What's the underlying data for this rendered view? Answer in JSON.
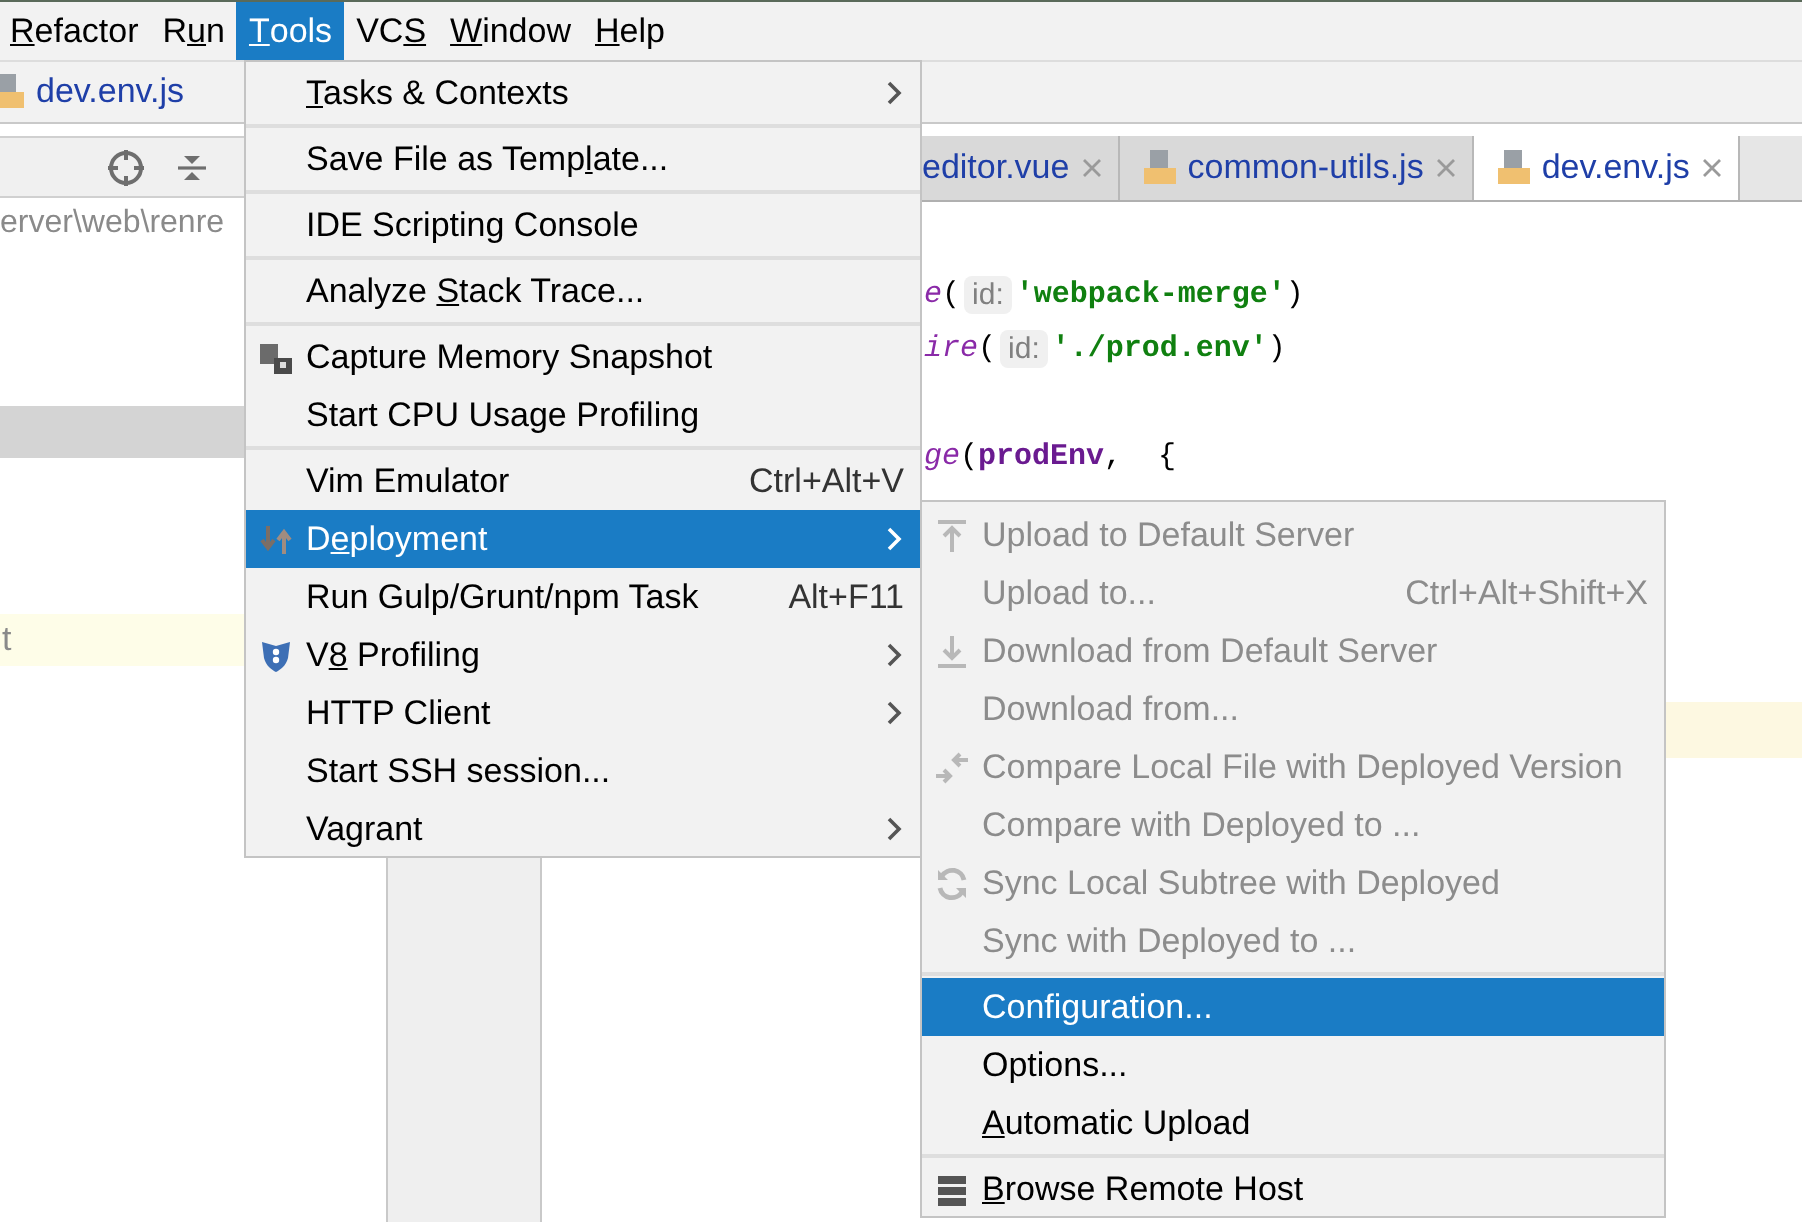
{
  "menubar": [
    {
      "label": "Refactor",
      "selected": false
    },
    {
      "label": "Run",
      "selected": false
    },
    {
      "label": "Tools",
      "selected": true
    },
    {
      "label": "VCS",
      "selected": false
    },
    {
      "label": "Window",
      "selected": false
    },
    {
      "label": "Help",
      "selected": false
    }
  ],
  "navbar": {
    "file": "dev.env.js"
  },
  "project_panel": {
    "path": "erver\\web\\renre",
    "row_text": "t"
  },
  "editor": {
    "tabs": [
      {
        "label": "editor.vue",
        "selected": false,
        "file_icon": false
      },
      {
        "label": "common-utils.js",
        "selected": false,
        "file_icon": true
      },
      {
        "label": "dev.env.js",
        "selected": true,
        "file_icon": true
      }
    ],
    "code_lines": [
      {
        "tokens": [
          {
            "kind": "call",
            "text": "e"
          },
          {
            "kind": "punct",
            "text": "("
          },
          {
            "kind": "hint",
            "text": "id:"
          },
          {
            "kind": "string",
            "text": "'webpack-merge'"
          },
          {
            "kind": "punct",
            "text": ")"
          }
        ]
      },
      {
        "tokens": [
          {
            "kind": "call",
            "text": "ire"
          },
          {
            "kind": "punct",
            "text": "("
          },
          {
            "kind": "hint",
            "text": "id:"
          },
          {
            "kind": "string",
            "text": "'./prod.env'"
          },
          {
            "kind": "punct",
            "text": ")"
          }
        ]
      },
      {
        "tokens": [
          {
            "kind": "call",
            "text": "ge"
          },
          {
            "kind": "punct",
            "text": "("
          },
          {
            "kind": "var",
            "text": "prodEnv"
          },
          {
            "kind": "punct",
            "text": ",  {"
          }
        ]
      }
    ]
  },
  "tools_menu": [
    {
      "kind": "submenu",
      "label": "Tasks & Contexts",
      "selected": false
    },
    {
      "kind": "separator"
    },
    {
      "kind": "item",
      "label": "Save File as Template...",
      "selected": false
    },
    {
      "kind": "separator"
    },
    {
      "kind": "item",
      "label": "IDE Scripting Console",
      "selected": false
    },
    {
      "kind": "separator"
    },
    {
      "kind": "item",
      "label": "Analyze Stack Trace...",
      "selected": false
    },
    {
      "kind": "separator"
    },
    {
      "kind": "item",
      "label": "Capture Memory Snapshot",
      "selected": false
    },
    {
      "kind": "item",
      "label": "Start CPU Usage Profiling",
      "selected": false
    },
    {
      "kind": "separator"
    },
    {
      "kind": "item",
      "label": "Vim Emulator",
      "shortcut": "Ctrl+Alt+V",
      "selected": false
    },
    {
      "kind": "submenu",
      "label": "Deployment",
      "selected": true
    },
    {
      "kind": "item",
      "label": "Run Gulp/Grunt/npm Task",
      "shortcut": "Alt+F11",
      "selected": false
    },
    {
      "kind": "submenu",
      "label": "V8 Profiling",
      "selected": false
    },
    {
      "kind": "submenu",
      "label": "HTTP Client",
      "selected": false
    },
    {
      "kind": "item",
      "label": "Start SSH session...",
      "selected": false
    },
    {
      "kind": "submenu",
      "label": "Vagrant",
      "selected": false
    }
  ],
  "deployment_menu": [
    {
      "kind": "item",
      "label": "Upload to Default Server",
      "disabled": true,
      "selected": false
    },
    {
      "kind": "item",
      "label": "Upload to...",
      "shortcut": "Ctrl+Alt+Shift+X",
      "disabled": true,
      "selected": false
    },
    {
      "kind": "item",
      "label": "Download from Default Server",
      "disabled": true,
      "selected": false
    },
    {
      "kind": "item",
      "label": "Download from...",
      "disabled": true,
      "selected": false
    },
    {
      "kind": "item",
      "label": "Compare Local File with Deployed Version",
      "disabled": true,
      "selected": false
    },
    {
      "kind": "item",
      "label": "Compare with Deployed to ...",
      "disabled": true,
      "selected": false
    },
    {
      "kind": "item",
      "label": "Sync Local Subtree with Deployed",
      "disabled": true,
      "selected": false
    },
    {
      "kind": "item",
      "label": "Sync with Deployed to ...",
      "disabled": true,
      "selected": false
    },
    {
      "kind": "separator"
    },
    {
      "kind": "item",
      "label": "Configuration...",
      "disabled": false,
      "selected": true
    },
    {
      "kind": "item",
      "label": "Options...",
      "disabled": false,
      "selected": false
    },
    {
      "kind": "item",
      "label": "Automatic Upload",
      "disabled": false,
      "selected": false
    },
    {
      "kind": "separator"
    },
    {
      "kind": "item",
      "label": "Browse Remote Host",
      "disabled": false,
      "selected": false
    }
  ]
}
